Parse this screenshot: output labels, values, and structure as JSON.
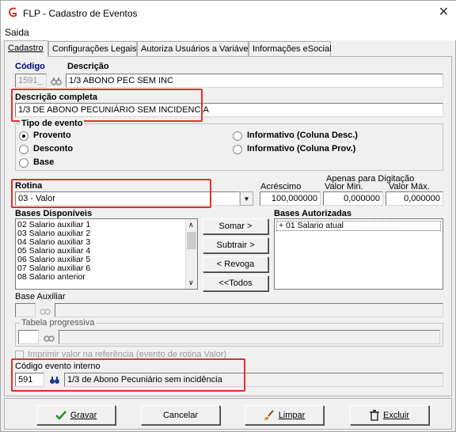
{
  "window": {
    "title": "FLP - Cadastro de Eventos",
    "close_symbol": "✕"
  },
  "menu": {
    "saida": "Saida"
  },
  "tabs": [
    {
      "label": "Cadastro",
      "active": true
    },
    {
      "label": "Configurações Legais"
    },
    {
      "label": "Autoriza Usuários a Variáveis"
    },
    {
      "label": "Informações eSocial"
    }
  ],
  "cadastro": {
    "codigo_label": "Código",
    "codigo_value": "1591_",
    "descricao_label": "Descrição",
    "descricao_value": "1/3 ABONO PEC SEM INC",
    "descricao_completa_label": "Descrição completa",
    "descricao_completa_value": "1/3 DE ABONO PECUNIÁRIO SEM INCIDENCIA",
    "tipo_evento": {
      "title": "Tipo de evento",
      "options": [
        {
          "label": "Provento",
          "selected": true
        },
        {
          "label": "Desconto",
          "selected": false
        },
        {
          "label": "Base",
          "selected": false
        },
        {
          "label": "Informativo (Coluna Desc.)",
          "selected": false
        },
        {
          "label": "Informativo (Coluna Prov.)",
          "selected": false
        }
      ]
    },
    "rotina_label": "Rotina",
    "rotina_value": "03 - Valor",
    "apenas_digitacao_label": "Apenas para Digitação",
    "acrescimo_label": "Acréscimo",
    "valor_min_label": "Valor Min.",
    "valor_max_label": "Valor Máx.",
    "acrescimo_value": "100,000000",
    "valor_min_value": "0,000000",
    "valor_max_value": "0,000000",
    "bases_disponiveis_label": "Bases Disponíveis",
    "bases_disponiveis": [
      "02 Salario auxiliar 1",
      "03 Salario auxiliar 2",
      "04 Salario auxiliar 3",
      "05 Salario auxiliar 4",
      "06 Salario auxiliar 5",
      "07 Salario auxiliar 6",
      "08 Salario anterior"
    ],
    "bases_autorizadas_label": "Bases Autorizadas",
    "bases_autorizadas": [
      "+ 01 Salario atual"
    ],
    "buttons": {
      "somar": "Somar >",
      "subtrair": "Subtrair >",
      "revoga": "< Revoga",
      "todos": "<<Todos"
    },
    "base_auxiliar_label": "Base Auxiliar",
    "tabela_progressiva_label": "Tabela progressiva",
    "imprimir_label": "Imprimir valor na referência (evento de rotina Valor)",
    "codigo_interno_label": "Código evento interno",
    "codigo_interno_value": "591",
    "codigo_interno_desc": "1/3 de Abono Pecuniário sem incidência"
  },
  "footer": {
    "gravar": "Gravar",
    "cancelar": "Cancelar",
    "limpar": "Limpar",
    "excluir": "Excluir"
  },
  "colors": {
    "highlight_box": "#e3302a",
    "window_bg": "#f0f0f0",
    "app_icon": "#d9302a"
  }
}
